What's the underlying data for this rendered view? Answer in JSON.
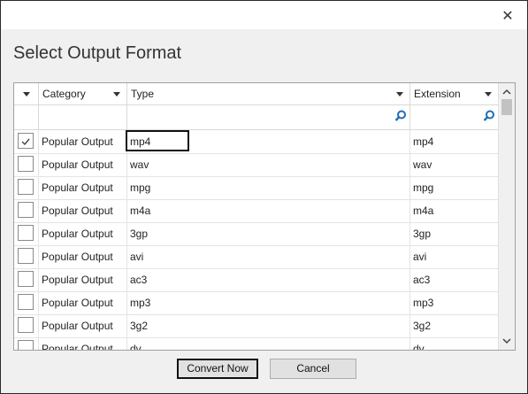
{
  "dialog": {
    "title": "Select Output Format",
    "close_glyph": "✕"
  },
  "grid": {
    "columns": [
      {
        "label": ""
      },
      {
        "label": "Category"
      },
      {
        "label": "Type"
      },
      {
        "label": "Extension"
      }
    ],
    "rows": [
      {
        "checked": true,
        "category": "Popular Output",
        "type": "mp4",
        "extension": "mp4"
      },
      {
        "checked": false,
        "category": "Popular Output",
        "type": "wav",
        "extension": "wav"
      },
      {
        "checked": false,
        "category": "Popular Output",
        "type": "mpg",
        "extension": "mpg"
      },
      {
        "checked": false,
        "category": "Popular Output",
        "type": "m4a",
        "extension": "m4a"
      },
      {
        "checked": false,
        "category": "Popular Output",
        "type": "3gp",
        "extension": "3gp"
      },
      {
        "checked": false,
        "category": "Popular Output",
        "type": "avi",
        "extension": "avi"
      },
      {
        "checked": false,
        "category": "Popular Output",
        "type": "ac3",
        "extension": "ac3"
      },
      {
        "checked": false,
        "category": "Popular Output",
        "type": "mp3",
        "extension": "mp3"
      },
      {
        "checked": false,
        "category": "Popular Output",
        "type": "3g2",
        "extension": "3g2"
      },
      {
        "checked": false,
        "category": "Popular Output",
        "type": "dv",
        "extension": "dv"
      }
    ]
  },
  "buttons": {
    "convert": "Convert Now",
    "cancel": "Cancel"
  },
  "colors": {
    "dialog_bg": "#f0f0f0",
    "grid_bg": "#ffffff",
    "search_icon": "#1e6fb5"
  }
}
